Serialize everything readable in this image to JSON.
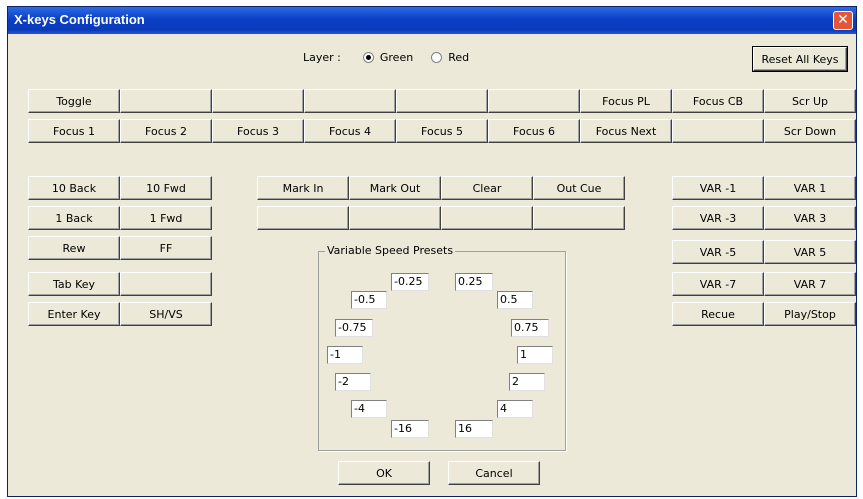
{
  "window": {
    "title": "X-keys Configuration",
    "close_glyph": "✕"
  },
  "layer": {
    "label": "Layer :",
    "options": [
      "Green",
      "Red"
    ],
    "selected": "Green"
  },
  "reset_label": "Reset All Keys",
  "focus_rows": {
    "row1": [
      "Toggle",
      "",
      "",
      "",
      "",
      "",
      "Focus PL",
      "Focus CB",
      "Scr Up"
    ],
    "row2": [
      "Focus 1",
      "Focus 2",
      "Focus 3",
      "Focus 4",
      "Focus 5",
      "Focus 6",
      "Focus Next",
      "",
      "Scr Down"
    ]
  },
  "left_keys": [
    [
      "10 Back",
      "10 Fwd"
    ],
    [
      "1 Back",
      "1 Fwd"
    ],
    [
      "Rew",
      "FF"
    ],
    [
      "Tab Key",
      ""
    ],
    [
      "Enter Key",
      "SH/VS"
    ]
  ],
  "mark_keys": [
    [
      "Mark In",
      "Mark Out",
      "Clear",
      "Out Cue"
    ],
    [
      "",
      "",
      "",
      ""
    ]
  ],
  "var_keys": [
    [
      "VAR -1",
      "VAR 1"
    ],
    [
      "VAR -3",
      "VAR 3"
    ],
    [
      "VAR -5",
      "VAR 5"
    ],
    [
      "VAR -7",
      "VAR 7"
    ],
    [
      "Recue",
      "Play/Stop"
    ]
  ],
  "presets": {
    "label": "Variable Speed Presets",
    "values": [
      "-0.25",
      "0.25",
      "-0.5",
      "0.5",
      "-0.75",
      "0.75",
      "-1",
      "1",
      "-2",
      "2",
      "-4",
      "4",
      "-16",
      "16"
    ]
  },
  "ok_label": "OK",
  "cancel_label": "Cancel"
}
